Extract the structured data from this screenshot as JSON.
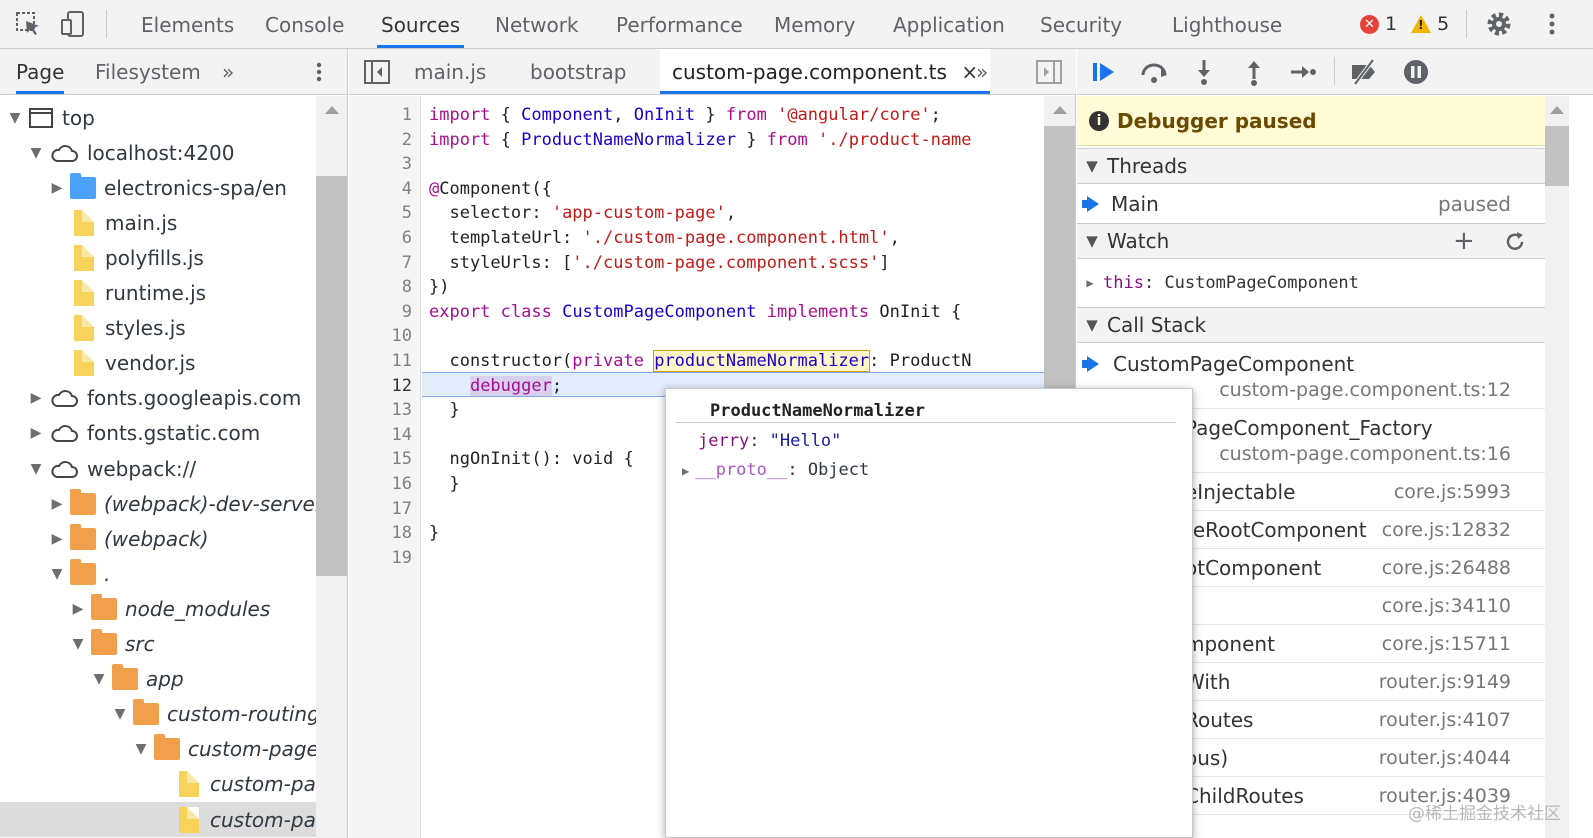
{
  "toolbar": {
    "icons": [
      "inspect-element-icon",
      "device-toolbar-icon",
      "settings-gear-icon",
      "more-menu-icon"
    ],
    "tabs": [
      {
        "label": "Elements",
        "active": false
      },
      {
        "label": "Console",
        "active": false
      },
      {
        "label": "Sources",
        "active": true
      },
      {
        "label": "Network",
        "active": false
      },
      {
        "label": "Performance",
        "active": false
      },
      {
        "label": "Memory",
        "active": false
      },
      {
        "label": "Application",
        "active": false
      },
      {
        "label": "Security",
        "active": false
      },
      {
        "label": "Lighthouse",
        "active": false
      }
    ],
    "error_count": "1",
    "warning_count": "5"
  },
  "navigator": {
    "tabs": [
      {
        "label": "Page",
        "active": true
      },
      {
        "label": "Filesystem",
        "active": false
      }
    ],
    "more": "»",
    "tree": [
      {
        "label": "top",
        "depth": 0,
        "icon": "frame-icon",
        "expanded": true
      },
      {
        "label": "localhost:4200",
        "depth": 1,
        "icon": "cloud-icon",
        "expanded": true
      },
      {
        "label": "electronics-spa/en",
        "depth": 2,
        "icon": "folder-blue-icon",
        "expanded": false
      },
      {
        "label": "main.js",
        "depth": 2,
        "icon": "file-icon"
      },
      {
        "label": "polyfills.js",
        "depth": 2,
        "icon": "file-icon"
      },
      {
        "label": "runtime.js",
        "depth": 2,
        "icon": "file-icon"
      },
      {
        "label": "styles.js",
        "depth": 2,
        "icon": "file-icon"
      },
      {
        "label": "vendor.js",
        "depth": 2,
        "icon": "file-icon"
      },
      {
        "label": "fonts.googleapis.com",
        "depth": 1,
        "icon": "cloud-icon",
        "expanded": false
      },
      {
        "label": "fonts.gstatic.com",
        "depth": 1,
        "icon": "cloud-icon",
        "expanded": false
      },
      {
        "label": "webpack://",
        "depth": 1,
        "icon": "cloud-icon",
        "expanded": true
      },
      {
        "label": "(webpack)-dev-server",
        "depth": 2,
        "icon": "folder-orange-icon",
        "expanded": false,
        "italic": true
      },
      {
        "label": "(webpack)",
        "depth": 2,
        "icon": "folder-orange-icon",
        "expanded": false,
        "italic": true
      },
      {
        "label": ".",
        "depth": 2,
        "icon": "folder-orange-icon",
        "expanded": true,
        "italic": true
      },
      {
        "label": "node_modules",
        "depth": 3,
        "icon": "folder-orange-icon",
        "expanded": false,
        "italic": true
      },
      {
        "label": "src",
        "depth": 3,
        "icon": "folder-orange-icon",
        "expanded": true,
        "italic": true
      },
      {
        "label": "app",
        "depth": 4,
        "icon": "folder-orange-icon",
        "expanded": true,
        "italic": true
      },
      {
        "label": "custom-routing",
        "depth": 5,
        "icon": "folder-orange-icon",
        "expanded": true,
        "italic": true
      },
      {
        "label": "custom-page",
        "depth": 6,
        "icon": "folder-orange-icon",
        "expanded": true,
        "italic": true
      },
      {
        "label": "custom-pag",
        "depth": 7,
        "icon": "file-icon",
        "italic": true
      },
      {
        "label": "custom-pag",
        "depth": 7,
        "icon": "file-icon",
        "italic": true,
        "selected": true
      }
    ]
  },
  "editor": {
    "tabs": [
      {
        "label": "main.js",
        "active": false
      },
      {
        "label": "bootstrap",
        "active": false
      },
      {
        "label": "custom-page.component.ts",
        "active": true,
        "close": "×"
      }
    ],
    "more": "»",
    "line_numbers": [
      "1",
      "2",
      "3",
      "4",
      "5",
      "6",
      "7",
      "8",
      "9",
      "10",
      "11",
      "12",
      "13",
      "14",
      "15",
      "16",
      "17",
      "18",
      "19"
    ],
    "paused_line": 12
  },
  "popover": {
    "title": "ProductNameNormalizer",
    "prop_key": "jerry",
    "prop_sep": ": ",
    "prop_value": "\"Hello\"",
    "proto_key": "__proto__",
    "proto_sep": ": ",
    "proto_value": "Object"
  },
  "debugger": {
    "buttons": [
      "resume-icon",
      "step-over-icon",
      "step-into-icon",
      "step-out-icon",
      "step-icon",
      "deactivate-breakpoints-icon",
      "pause-on-exceptions-icon"
    ],
    "banner": "Debugger paused",
    "threads_title": "Threads",
    "thread_name": "Main",
    "thread_status": "paused",
    "watch_title": "Watch",
    "watch_key": "this",
    "watch_sep": ": ",
    "watch_value": "CustomPageComponent",
    "callstack_title": "Call Stack",
    "frames": [
      {
        "name": "CustomPageComponent",
        "loc": "custom-page.component.ts:12",
        "two_line": true,
        "current": true
      },
      {
        "name": "PageComponent_Factory",
        "loc": "custom-page.component.ts:16",
        "two_line": true
      },
      {
        "name": "eInjectable",
        "loc": "core.js:5993"
      },
      {
        "name": "teRootComponent",
        "loc": "core.js:12832"
      },
      {
        "name": "otComponent",
        "loc": "core.js:26488"
      },
      {
        "name": "",
        "loc": "core.js:34110"
      },
      {
        "name": "mponent",
        "loc": "core.js:15711"
      },
      {
        "name": "With",
        "loc": "router.js:9149"
      },
      {
        "name": "Routes",
        "loc": "router.js:4107"
      },
      {
        "name": "ous)",
        "loc": "router.js:4044"
      },
      {
        "name": "ChildRoutes",
        "loc": "router.js:4039"
      }
    ]
  },
  "watermark": "@稀土掘金技术社区"
}
